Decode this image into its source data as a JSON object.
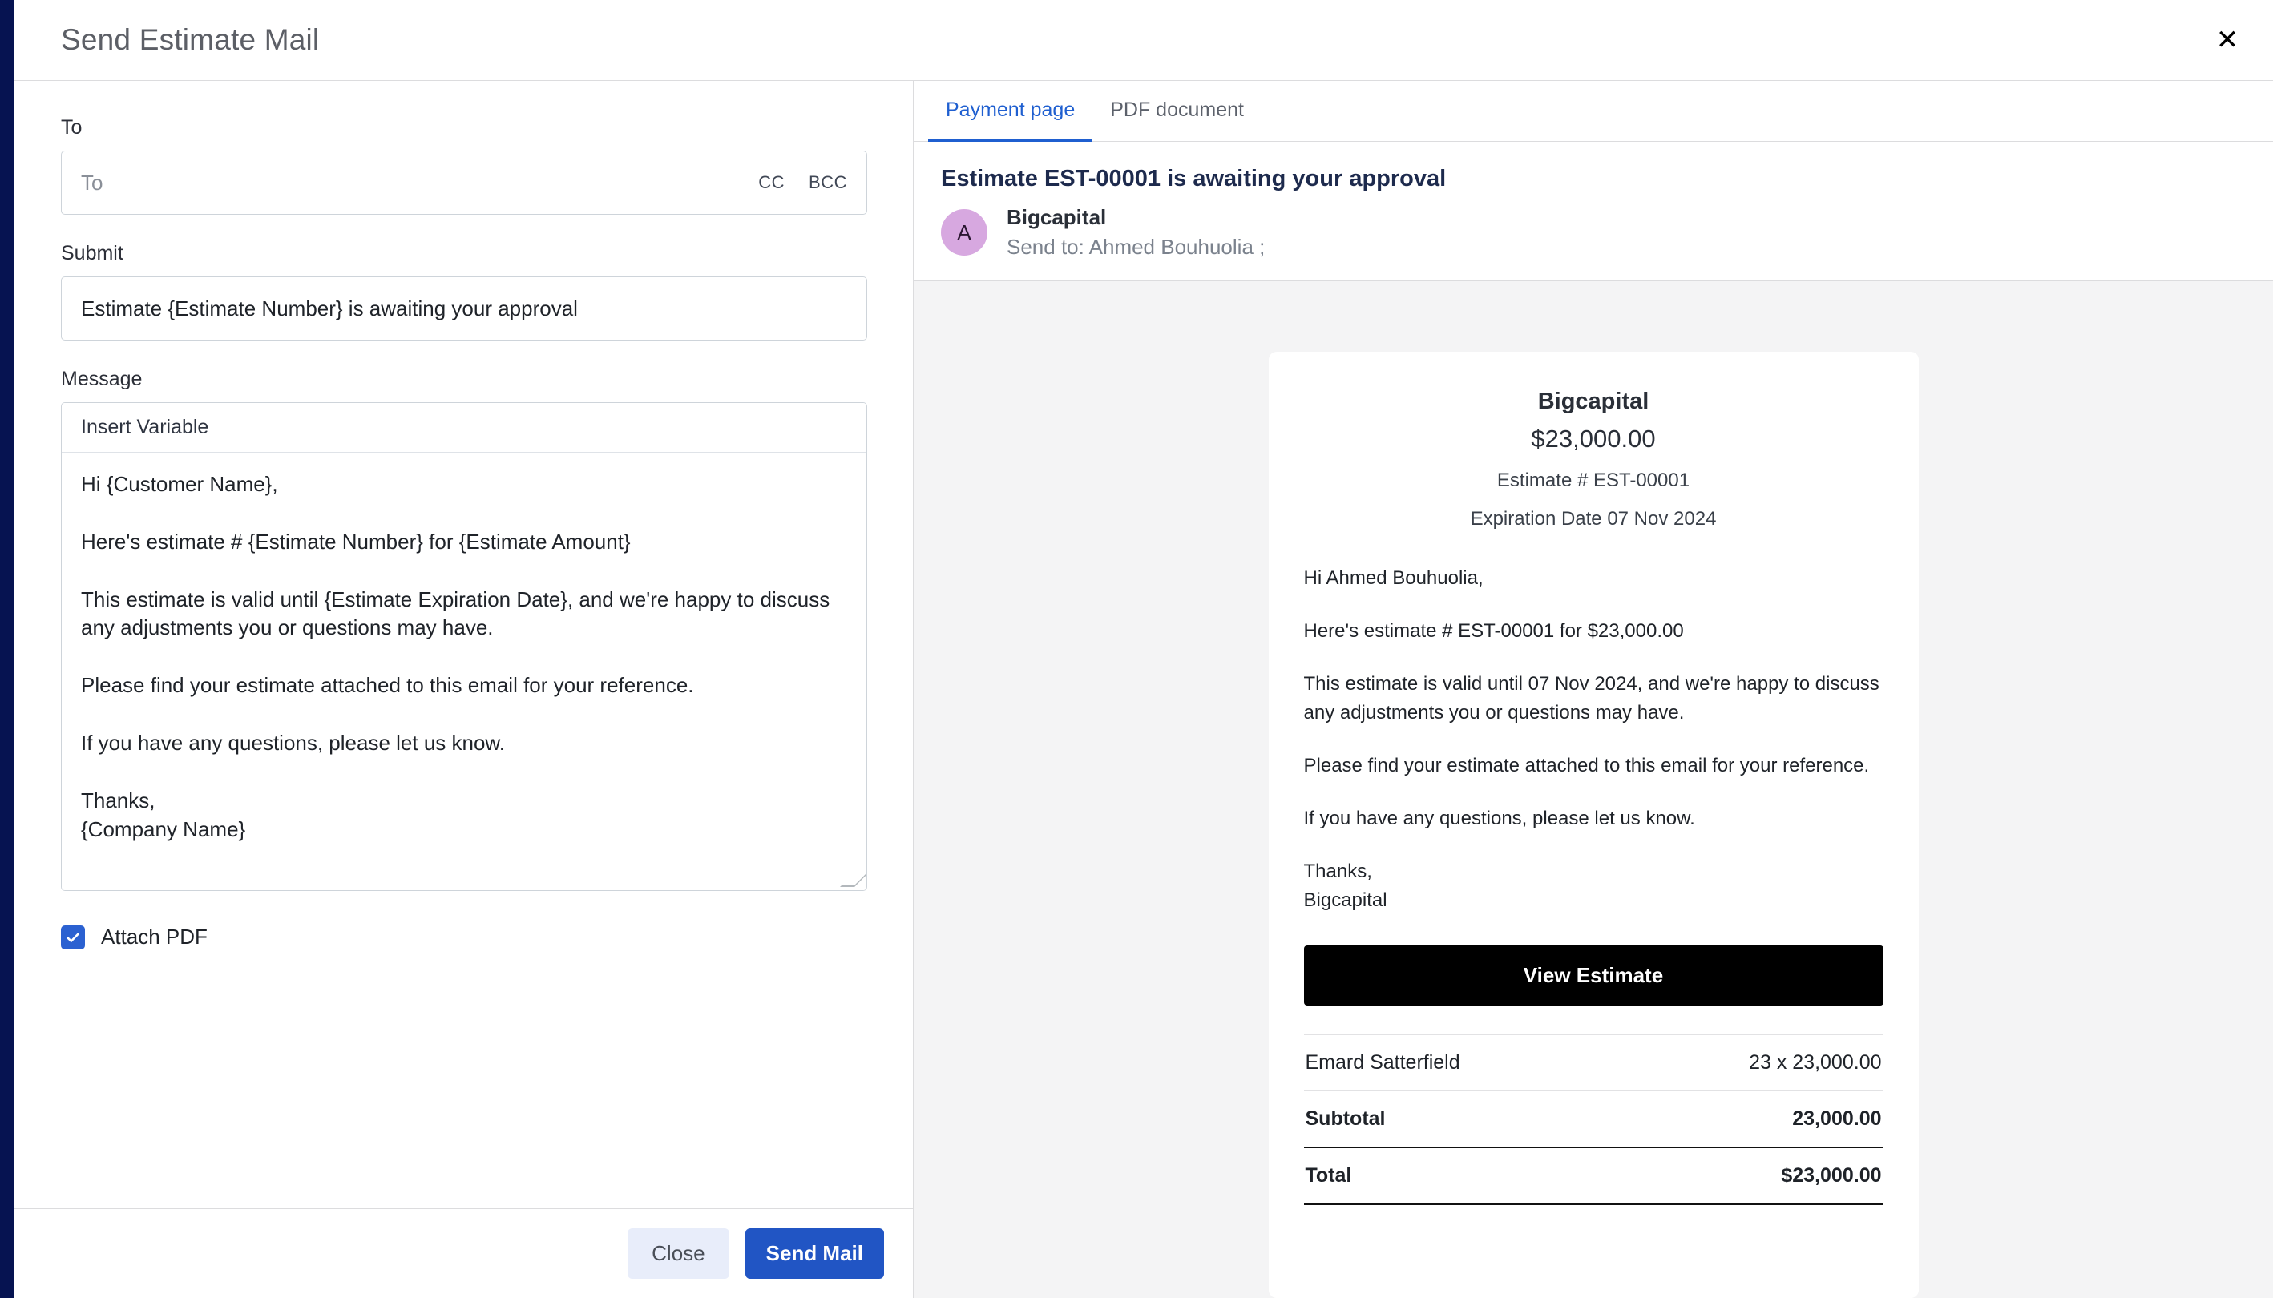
{
  "modal": {
    "title": "Send Estimate Mail",
    "close_icon": "close-icon"
  },
  "form": {
    "to": {
      "label": "To",
      "placeholder": "To",
      "value": "",
      "cc": "CC",
      "bcc": "BCC"
    },
    "subject": {
      "label": "Submit",
      "value": "Estimate {Estimate Number} is awaiting your approval"
    },
    "message": {
      "label": "Message",
      "insert_variable": "Insert Variable",
      "value": "Hi {Customer Name},\n\nHere's estimate # {Estimate Number} for {Estimate Amount}\n\nThis estimate is valid until {Estimate Expiration Date}, and we're happy to discuss any adjustments you or questions may have.\n\nPlease find your estimate attached to this email for your reference.\n\nIf you have any questions, please let us know.\n\nThanks,\n{Company Name}"
    },
    "attach_pdf": {
      "label": "Attach PDF",
      "checked": true
    }
  },
  "footer": {
    "close_label": "Close",
    "send_label": "Send Mail"
  },
  "preview": {
    "tabs": [
      {
        "label": "Payment page",
        "active": true
      },
      {
        "label": "PDF document",
        "active": false
      }
    ],
    "mail": {
      "subject": "Estimate EST-00001 is awaiting your approval",
      "avatar_initial": "A",
      "from_name": "Bigcapital",
      "send_to": "Send to: Ahmed Bouhuolia ;"
    },
    "card": {
      "company": "Bigcapital",
      "amount": "$23,000.00",
      "estimate_no": "Estimate # EST-00001",
      "expiration": "Expiration Date 07 Nov 2024",
      "greeting": "Hi Ahmed Bouhuolia,",
      "para_1": "Here's estimate # EST-00001 for $23,000.00",
      "para_2": "This estimate is valid until 07 Nov 2024, and we're happy to discuss any adjustments you or questions may have.",
      "para_3": "Please find your estimate attached to this email for your reference.",
      "para_4": "If you have any questions, please let us know.",
      "sign_off": "Thanks,\nBigcapital",
      "view_button": "View Estimate",
      "line_item": {
        "name": "Emard Satterfield",
        "value": "23 x 23,000.00"
      },
      "subtotal": {
        "label": "Subtotal",
        "value": "23,000.00"
      },
      "total": {
        "label": "Total",
        "value": "$23,000.00"
      }
    }
  },
  "colors": {
    "brand_navy": "#061351",
    "accent_blue": "#2155c4",
    "tab_active": "#1f5fd0",
    "checkbox_blue": "#2b61d1",
    "avatar_purple": "#d7a8e0",
    "panel_bg": "#f4f4f5"
  }
}
